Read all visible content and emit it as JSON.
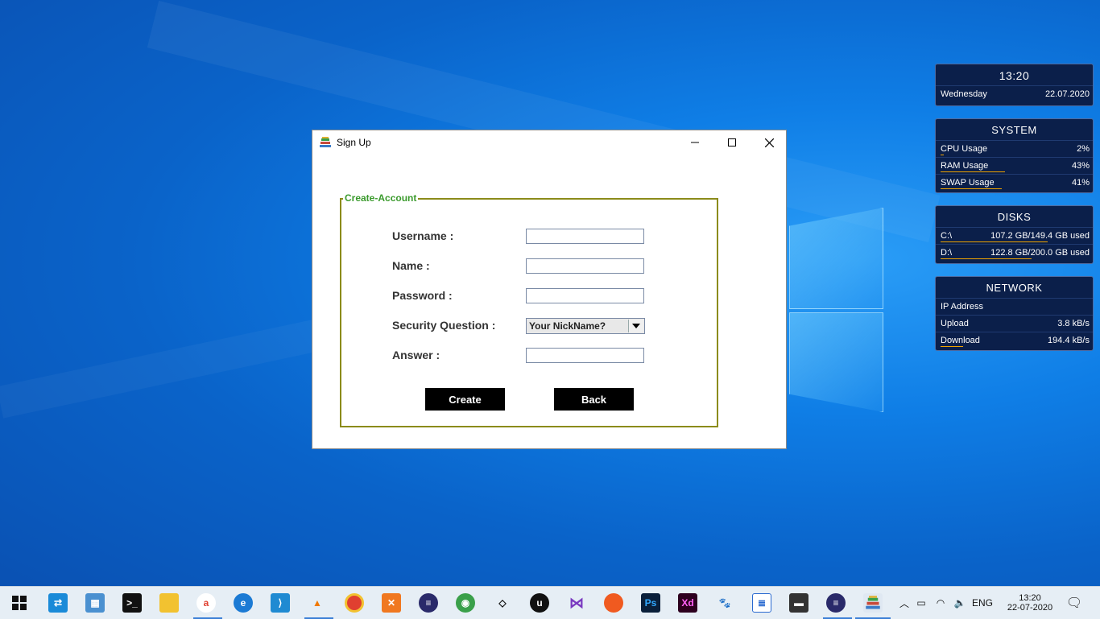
{
  "window": {
    "title": "Sign Up",
    "legend": "Create-Account",
    "fields": {
      "username_label": "Username :",
      "name_label": "Name :",
      "password_label": "Password :",
      "security_label": "Security Question :",
      "answer_label": "Answer :"
    },
    "security_selected": "Your NickName?",
    "buttons": {
      "create": "Create",
      "back": "Back"
    }
  },
  "gadgets": {
    "clock": {
      "time": "13:20",
      "day": "Wednesday",
      "date": "22.07.2020"
    },
    "system": {
      "title": "SYSTEM",
      "rows": [
        {
          "label": "CPU Usage",
          "value": "2%",
          "level": 0.02
        },
        {
          "label": "RAM Usage",
          "value": "43%",
          "level": 0.43
        },
        {
          "label": "SWAP Usage",
          "value": "41%",
          "level": 0.41
        }
      ]
    },
    "disks": {
      "title": "DISKS",
      "rows": [
        {
          "label": "C:\\",
          "value": "107.2 GB/149.4 GB used",
          "level": 0.72
        },
        {
          "label": "D:\\",
          "value": "122.8 GB/200.0 GB used",
          "level": 0.61
        }
      ]
    },
    "network": {
      "title": "NETWORK",
      "rows": [
        {
          "label": "IP Address",
          "value": ""
        },
        {
          "label": "Upload",
          "value": "3.8 kB/s"
        },
        {
          "label": "Download",
          "value": "194.4 kB/s"
        }
      ]
    }
  },
  "taskbar": {
    "apps": [
      "windows-start-icon",
      "remote-desktop-icon",
      "control-panel-icon",
      "terminal-icon",
      "file-explorer-icon",
      "office-icon",
      "edge-icon",
      "vscode-icon",
      "vlc-icon",
      "chrome-icon",
      "xampp-icon",
      "eclipse-icon",
      "android-studio-icon",
      "unity-icon",
      "unreal-icon",
      "visual-studio-icon",
      "firefox-icon",
      "photoshop-icon",
      "adobe-xd-icon",
      "gimp-icon",
      "notepad-icon",
      "scanner-icon",
      "eclipse-2-icon",
      "books-app-icon"
    ],
    "tray": {
      "language": "ENG",
      "time": "13:20",
      "date": "22-07-2020"
    }
  },
  "colors": {
    "legend_green": "#3a9a2c",
    "fieldset_border": "#8b8b1a",
    "gadget_bg": "#0b1f4a",
    "bar_orange": "#f0a400"
  }
}
